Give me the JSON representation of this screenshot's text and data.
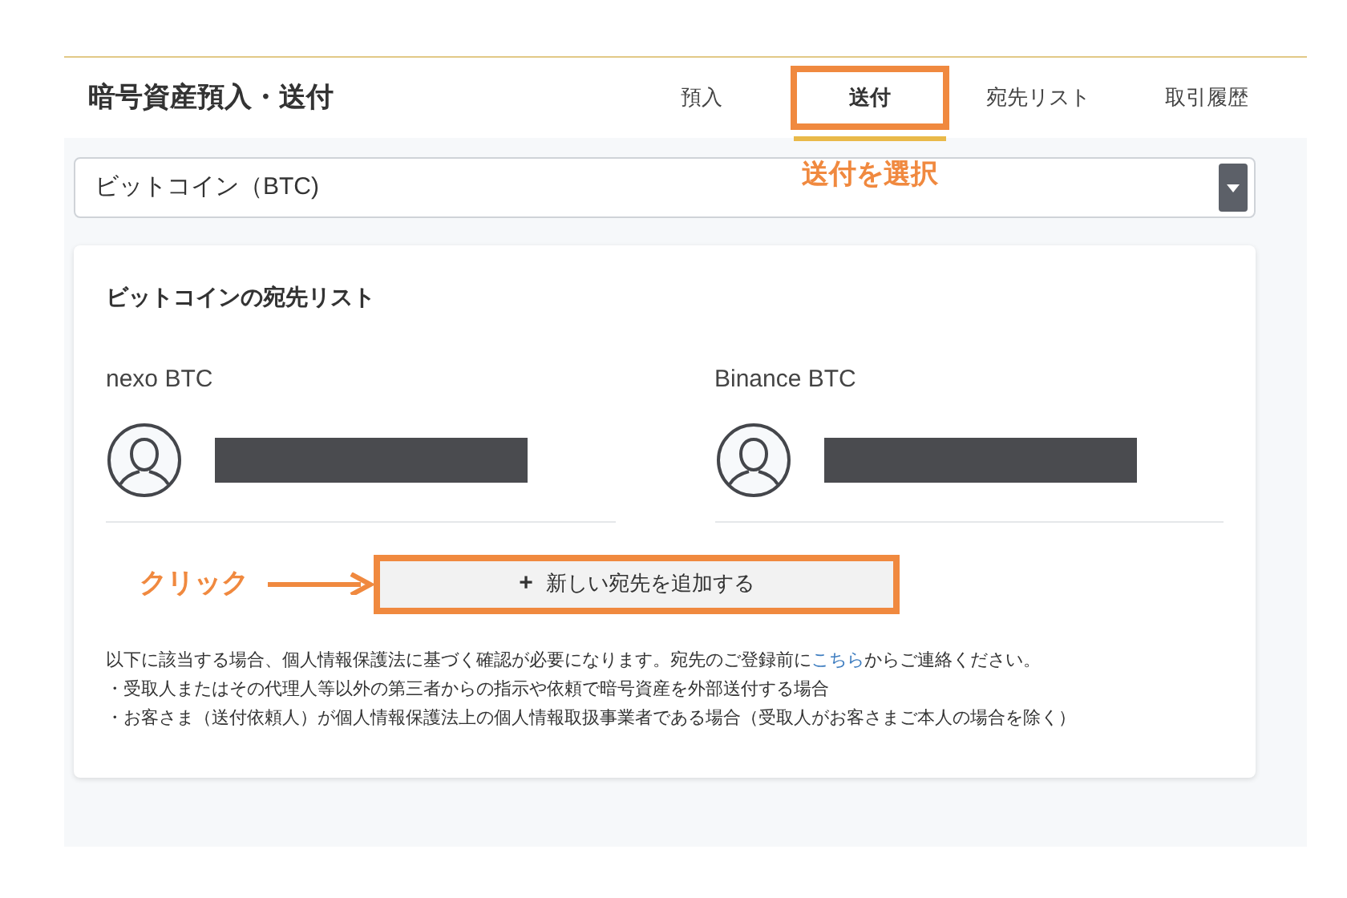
{
  "header": {
    "title": "暗号資産預入・送付"
  },
  "tabs": [
    {
      "label": "預入",
      "selected": false
    },
    {
      "label": "送付",
      "selected": true
    },
    {
      "label": "宛先リスト",
      "selected": false
    },
    {
      "label": "取引履歴",
      "selected": false
    }
  ],
  "tab_callout": "送付を選択",
  "currency_select": {
    "value": "ビットコイン（BTC)"
  },
  "card": {
    "title": "ビットコインの宛先リスト",
    "addresses": [
      {
        "name": "nexo BTC"
      },
      {
        "name": "Binance BTC"
      }
    ],
    "add_button": {
      "icon": "+",
      "label": "新しい宛先を追加する"
    },
    "click_callout": "クリック",
    "notice": {
      "before": "以下に該当する場合、個人情報保護法に基づく確認が必要になります。宛先のご登録前に",
      "link": "こちら",
      "after": "からご連絡ください。"
    },
    "conditions": [
      "・受取人またはその代理人等以外の第三者からの指示や依頼で暗号資産を外部送付する場合",
      "・お客さま（送付依頼人）が個人情報保護法上の個人情報取扱事業者である場合（受取人がお客さまご本人の場合を除く）"
    ]
  }
}
